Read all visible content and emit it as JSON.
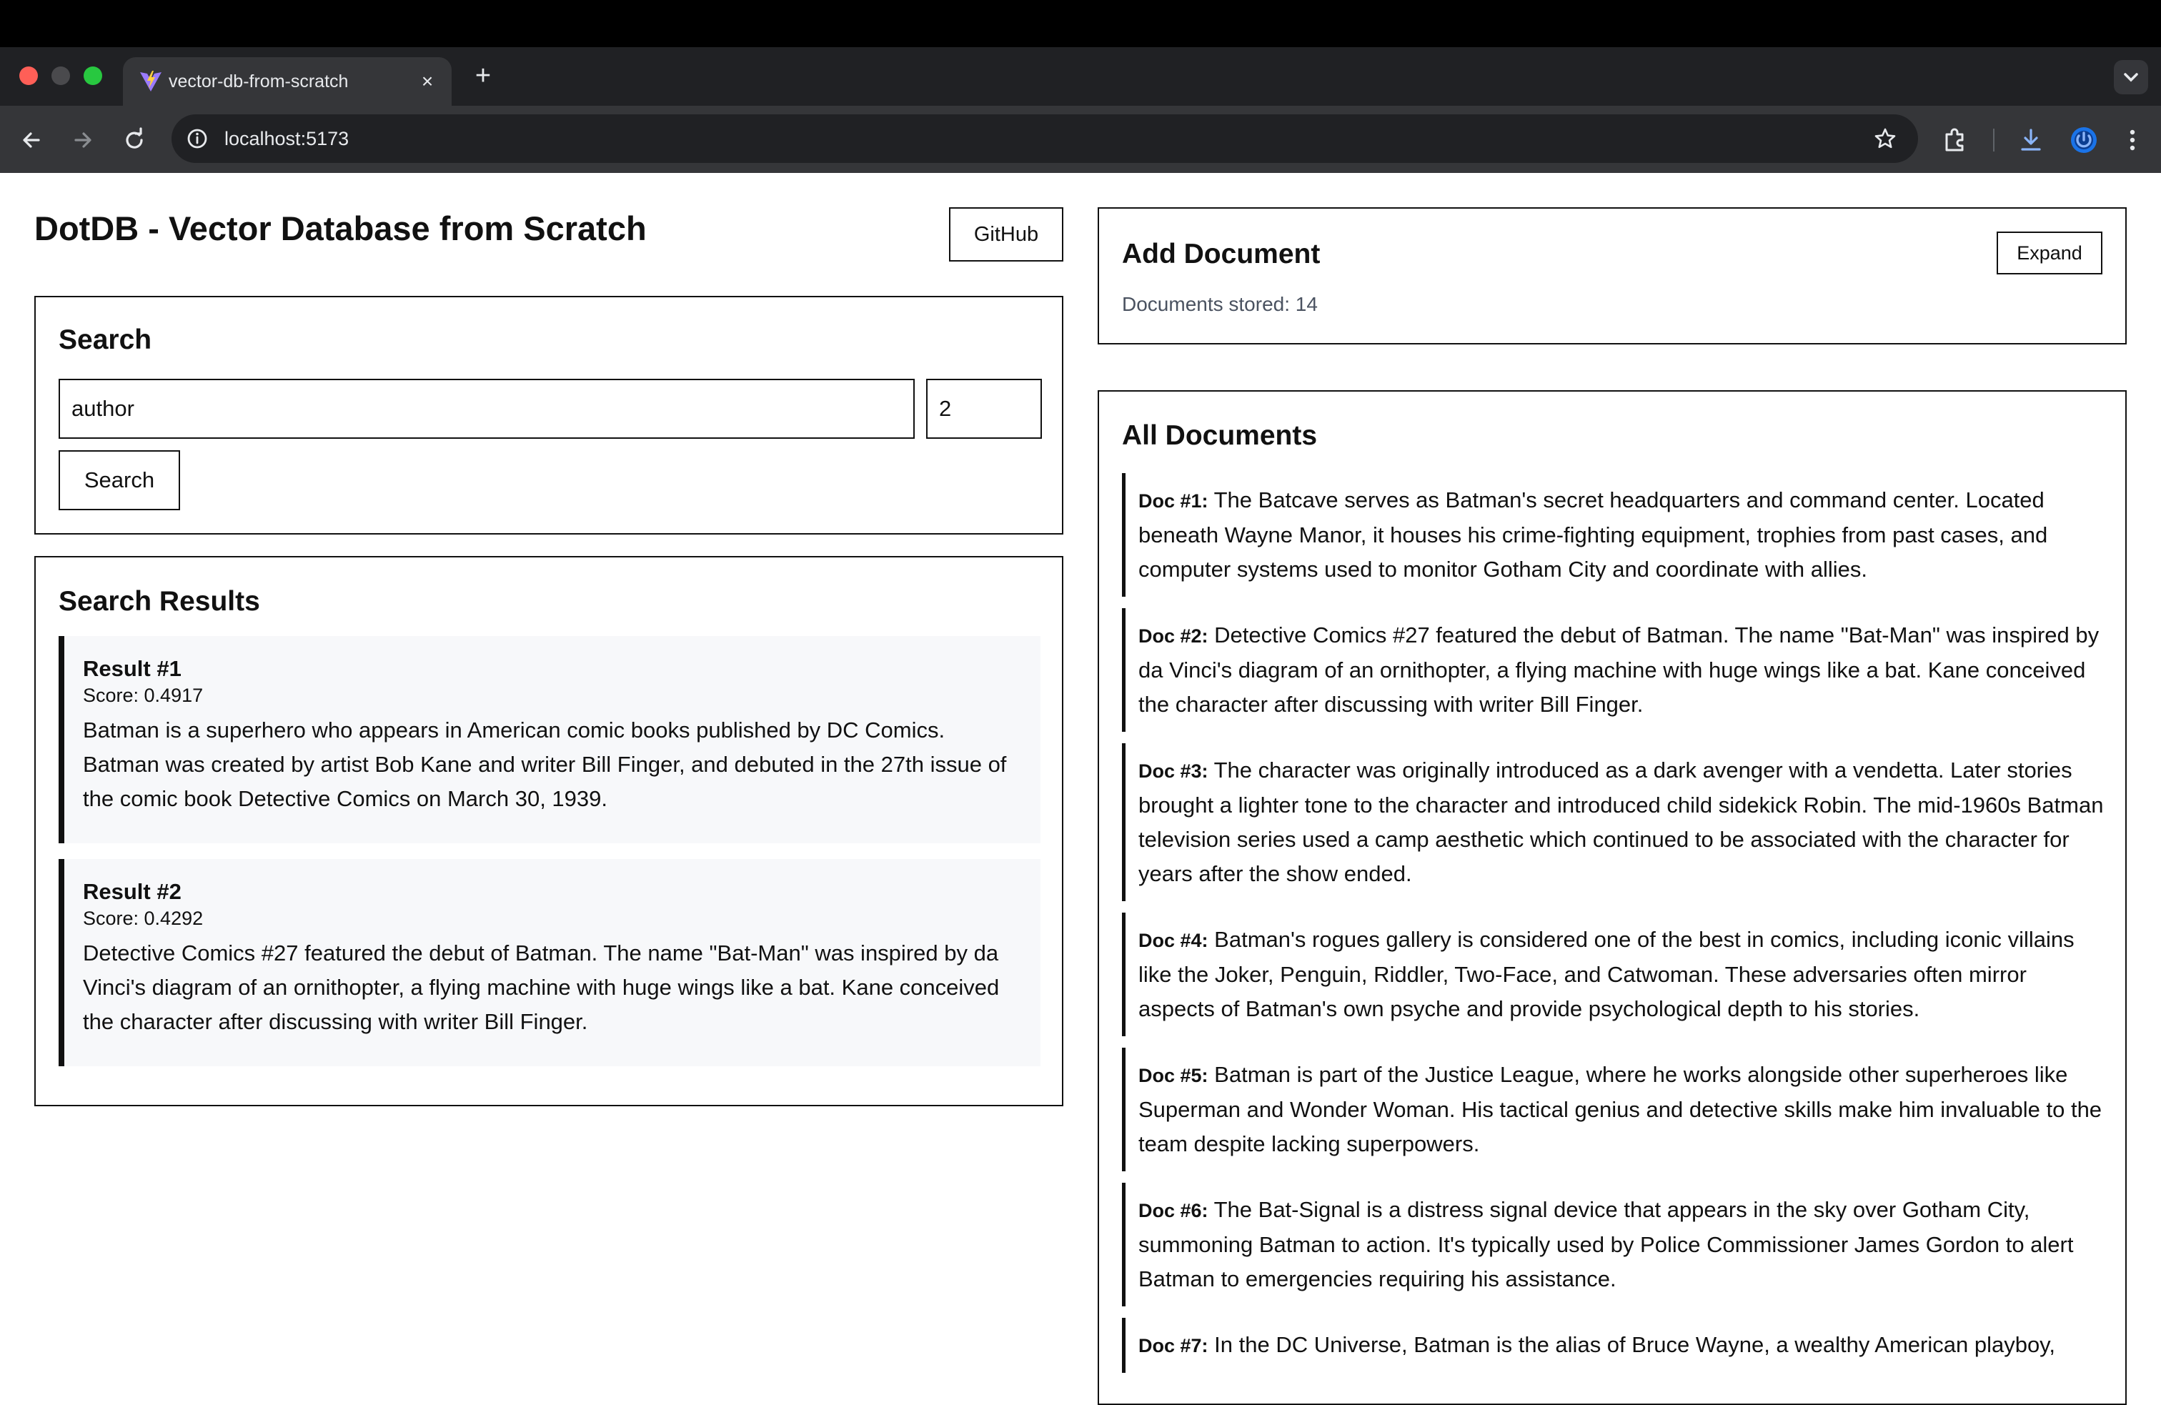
{
  "browser": {
    "tab_title": "vector-db-from-scratch",
    "url": "localhost:5173"
  },
  "header": {
    "title": "DotDB - Vector Database from Scratch",
    "github_label": "GitHub"
  },
  "search": {
    "heading": "Search",
    "query_value": "author",
    "k_value": "2",
    "button_label": "Search"
  },
  "results": {
    "heading": "Search Results",
    "items": [
      {
        "title": "Result #1",
        "score": "Score: 0.4917",
        "text": "Batman is a superhero who appears in American comic books published by DC Comics. Batman was created by artist Bob Kane and writer Bill Finger, and debuted in the 27th issue of the comic book Detective Comics on March 30, 1939."
      },
      {
        "title": "Result #2",
        "score": "Score: 0.4292",
        "text": "Detective Comics #27 featured the debut of Batman. The name \"Bat-Man\" was inspired by da Vinci's diagram of an ornithopter, a flying machine with huge wings like a bat. Kane conceived the character after discussing with writer Bill Finger."
      }
    ]
  },
  "add_document": {
    "heading": "Add Document",
    "expand_label": "Expand",
    "count_text": "Documents stored: 14"
  },
  "all_documents": {
    "heading": "All Documents",
    "items": [
      {
        "label": "Doc #1:",
        "text": "The Batcave serves as Batman's secret headquarters and command center. Located beneath Wayne Manor, it houses his crime-fighting equipment, trophies from past cases, and computer systems used to monitor Gotham City and coordinate with allies."
      },
      {
        "label": "Doc #2:",
        "text": "Detective Comics #27 featured the debut of Batman. The name \"Bat-Man\" was inspired by da Vinci's diagram of an ornithopter, a flying machine with huge wings like a bat. Kane conceived the character after discussing with writer Bill Finger."
      },
      {
        "label": "Doc #3:",
        "text": "The character was originally introduced as a dark avenger with a vendetta. Later stories brought a lighter tone to the character and introduced child sidekick Robin. The mid-1960s Batman television series used a camp aesthetic which continued to be associated with the character for years after the show ended."
      },
      {
        "label": "Doc #4:",
        "text": "Batman's rogues gallery is considered one of the best in comics, including iconic villains like the Joker, Penguin, Riddler, Two-Face, and Catwoman. These adversaries often mirror aspects of Batman's own psyche and provide psychological depth to his stories."
      },
      {
        "label": "Doc #5:",
        "text": "Batman is part of the Justice League, where he works alongside other superheroes like Superman and Wonder Woman. His tactical genius and detective skills make him invaluable to the team despite lacking superpowers."
      },
      {
        "label": "Doc #6:",
        "text": "The Bat-Signal is a distress signal device that appears in the sky over Gotham City, summoning Batman to action. It's typically used by Police Commissioner James Gordon to alert Batman to emergencies requiring his assistance."
      },
      {
        "label": "Doc #7:",
        "text": "In the DC Universe, Batman is the alias of Bruce Wayne, a wealthy American playboy,"
      }
    ]
  }
}
